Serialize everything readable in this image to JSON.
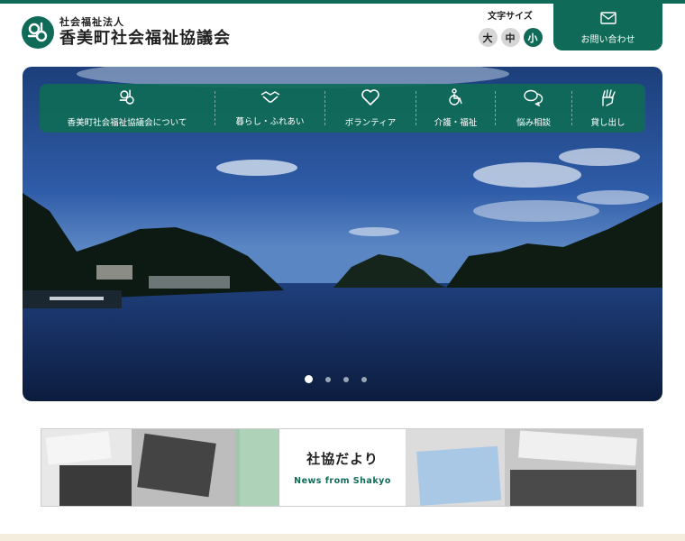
{
  "header": {
    "org_type": "社会福祉法人",
    "org_name": "香美町社会福祉協議会",
    "logo_icon": "org-logo-icon",
    "brand_color": "#0f6b57"
  },
  "font_size": {
    "label": "文字サイズ",
    "options": [
      "大",
      "中",
      "小"
    ],
    "selected": "小"
  },
  "contact": {
    "label": "お問い合わせ",
    "icon": "mail-icon"
  },
  "nav": {
    "items": [
      {
        "label": "香美町社会福祉協議会について",
        "icon": "org-logo-icon"
      },
      {
        "label": "暮らし・ふれあい",
        "icon": "handshake-icon"
      },
      {
        "label": "ボランティア",
        "icon": "heart-icon"
      },
      {
        "label": "介護・福祉",
        "icon": "wheelchair-icon"
      },
      {
        "label": "悩み相談",
        "icon": "speech-bubbles-icon"
      },
      {
        "label": "貸し出し",
        "icon": "hand-rental-icon"
      }
    ]
  },
  "slider": {
    "dots": 4,
    "active_index": 0
  },
  "banner": {
    "title": "社協だより",
    "subtitle": "News from Shakyo"
  }
}
